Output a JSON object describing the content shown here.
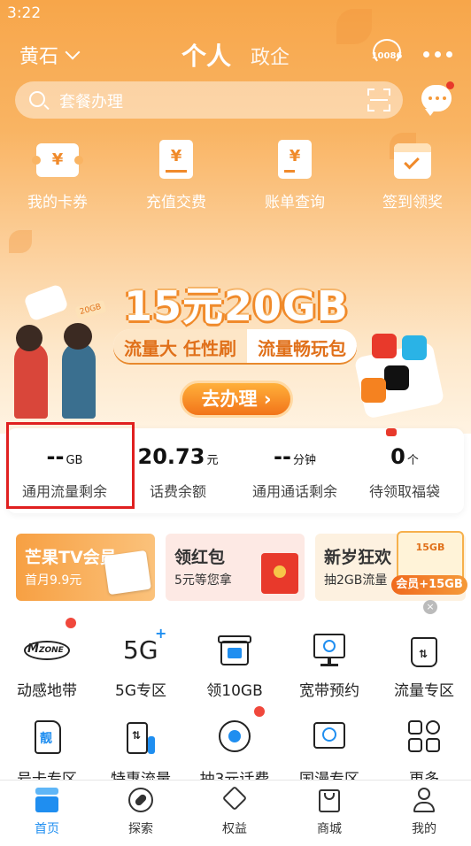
{
  "status_bar": {
    "time": "3:22"
  },
  "header": {
    "city": "黄石",
    "tabs": [
      "个人",
      "政企"
    ],
    "service_number": "10086"
  },
  "search": {
    "placeholder": "套餐办理"
  },
  "quick_actions": [
    {
      "label": "我的卡券",
      "icon": "coupon-icon"
    },
    {
      "label": "充值交费",
      "icon": "recharge-icon"
    },
    {
      "label": "账单查询",
      "icon": "bill-icon"
    },
    {
      "label": "签到领奖",
      "icon": "checkin-icon"
    }
  ],
  "banner": {
    "headline": "15元20GB",
    "tag1": "流量大 任性刷",
    "tag2": "流量畅玩包",
    "cta": "去办理",
    "small_tag": "20GB"
  },
  "balances": [
    {
      "value": "--",
      "unit": "GB",
      "label": "通用流量剩余"
    },
    {
      "value": "20.73",
      "unit": "元",
      "label": "话费余额"
    },
    {
      "value": "--",
      "unit": "分钟",
      "label": "通用通话剩余"
    },
    {
      "value": "0",
      "unit": "个",
      "label": "待领取福袋"
    }
  ],
  "promos": [
    {
      "title": "芒果TV会员",
      "subtitle": "首月9.9元"
    },
    {
      "title": "领红包",
      "subtitle": "5元等您拿"
    },
    {
      "title": "新岁狂欢",
      "subtitle": "抽2GB流量"
    }
  ],
  "gift_badge": {
    "top": "15GB",
    "plate": "会员+15GB"
  },
  "services_row1": [
    {
      "label": "动感地带",
      "icon": "mzone-icon"
    },
    {
      "label": "5G专区",
      "icon": "5g-icon"
    },
    {
      "label": "领10GB",
      "icon": "gift-box-icon"
    },
    {
      "label": "宽带预约",
      "icon": "broadband-icon"
    },
    {
      "label": "流量专区",
      "icon": "data-bag-icon"
    }
  ],
  "services_row2": [
    {
      "label": "号卡专区",
      "icon": "sim-card-icon"
    },
    {
      "label": "特惠流量",
      "icon": "data-pump-icon"
    },
    {
      "label": "抽3元话费",
      "icon": "lottery-icon"
    },
    {
      "label": "国漫专区",
      "icon": "anime-icon"
    },
    {
      "label": "更多",
      "icon": "more-grid-icon"
    }
  ],
  "tabbar": [
    {
      "label": "首页",
      "icon": "home-icon",
      "active": true
    },
    {
      "label": "探索",
      "icon": "compass-icon",
      "active": false
    },
    {
      "label": "权益",
      "icon": "diamond-icon",
      "active": false
    },
    {
      "label": "商城",
      "icon": "bag-icon",
      "active": false
    },
    {
      "label": "我的",
      "icon": "profile-icon",
      "active": false
    }
  ],
  "colors": {
    "accent": "#f59a3a",
    "active_tab": "#1f8ef0",
    "alert": "#e8392b"
  }
}
